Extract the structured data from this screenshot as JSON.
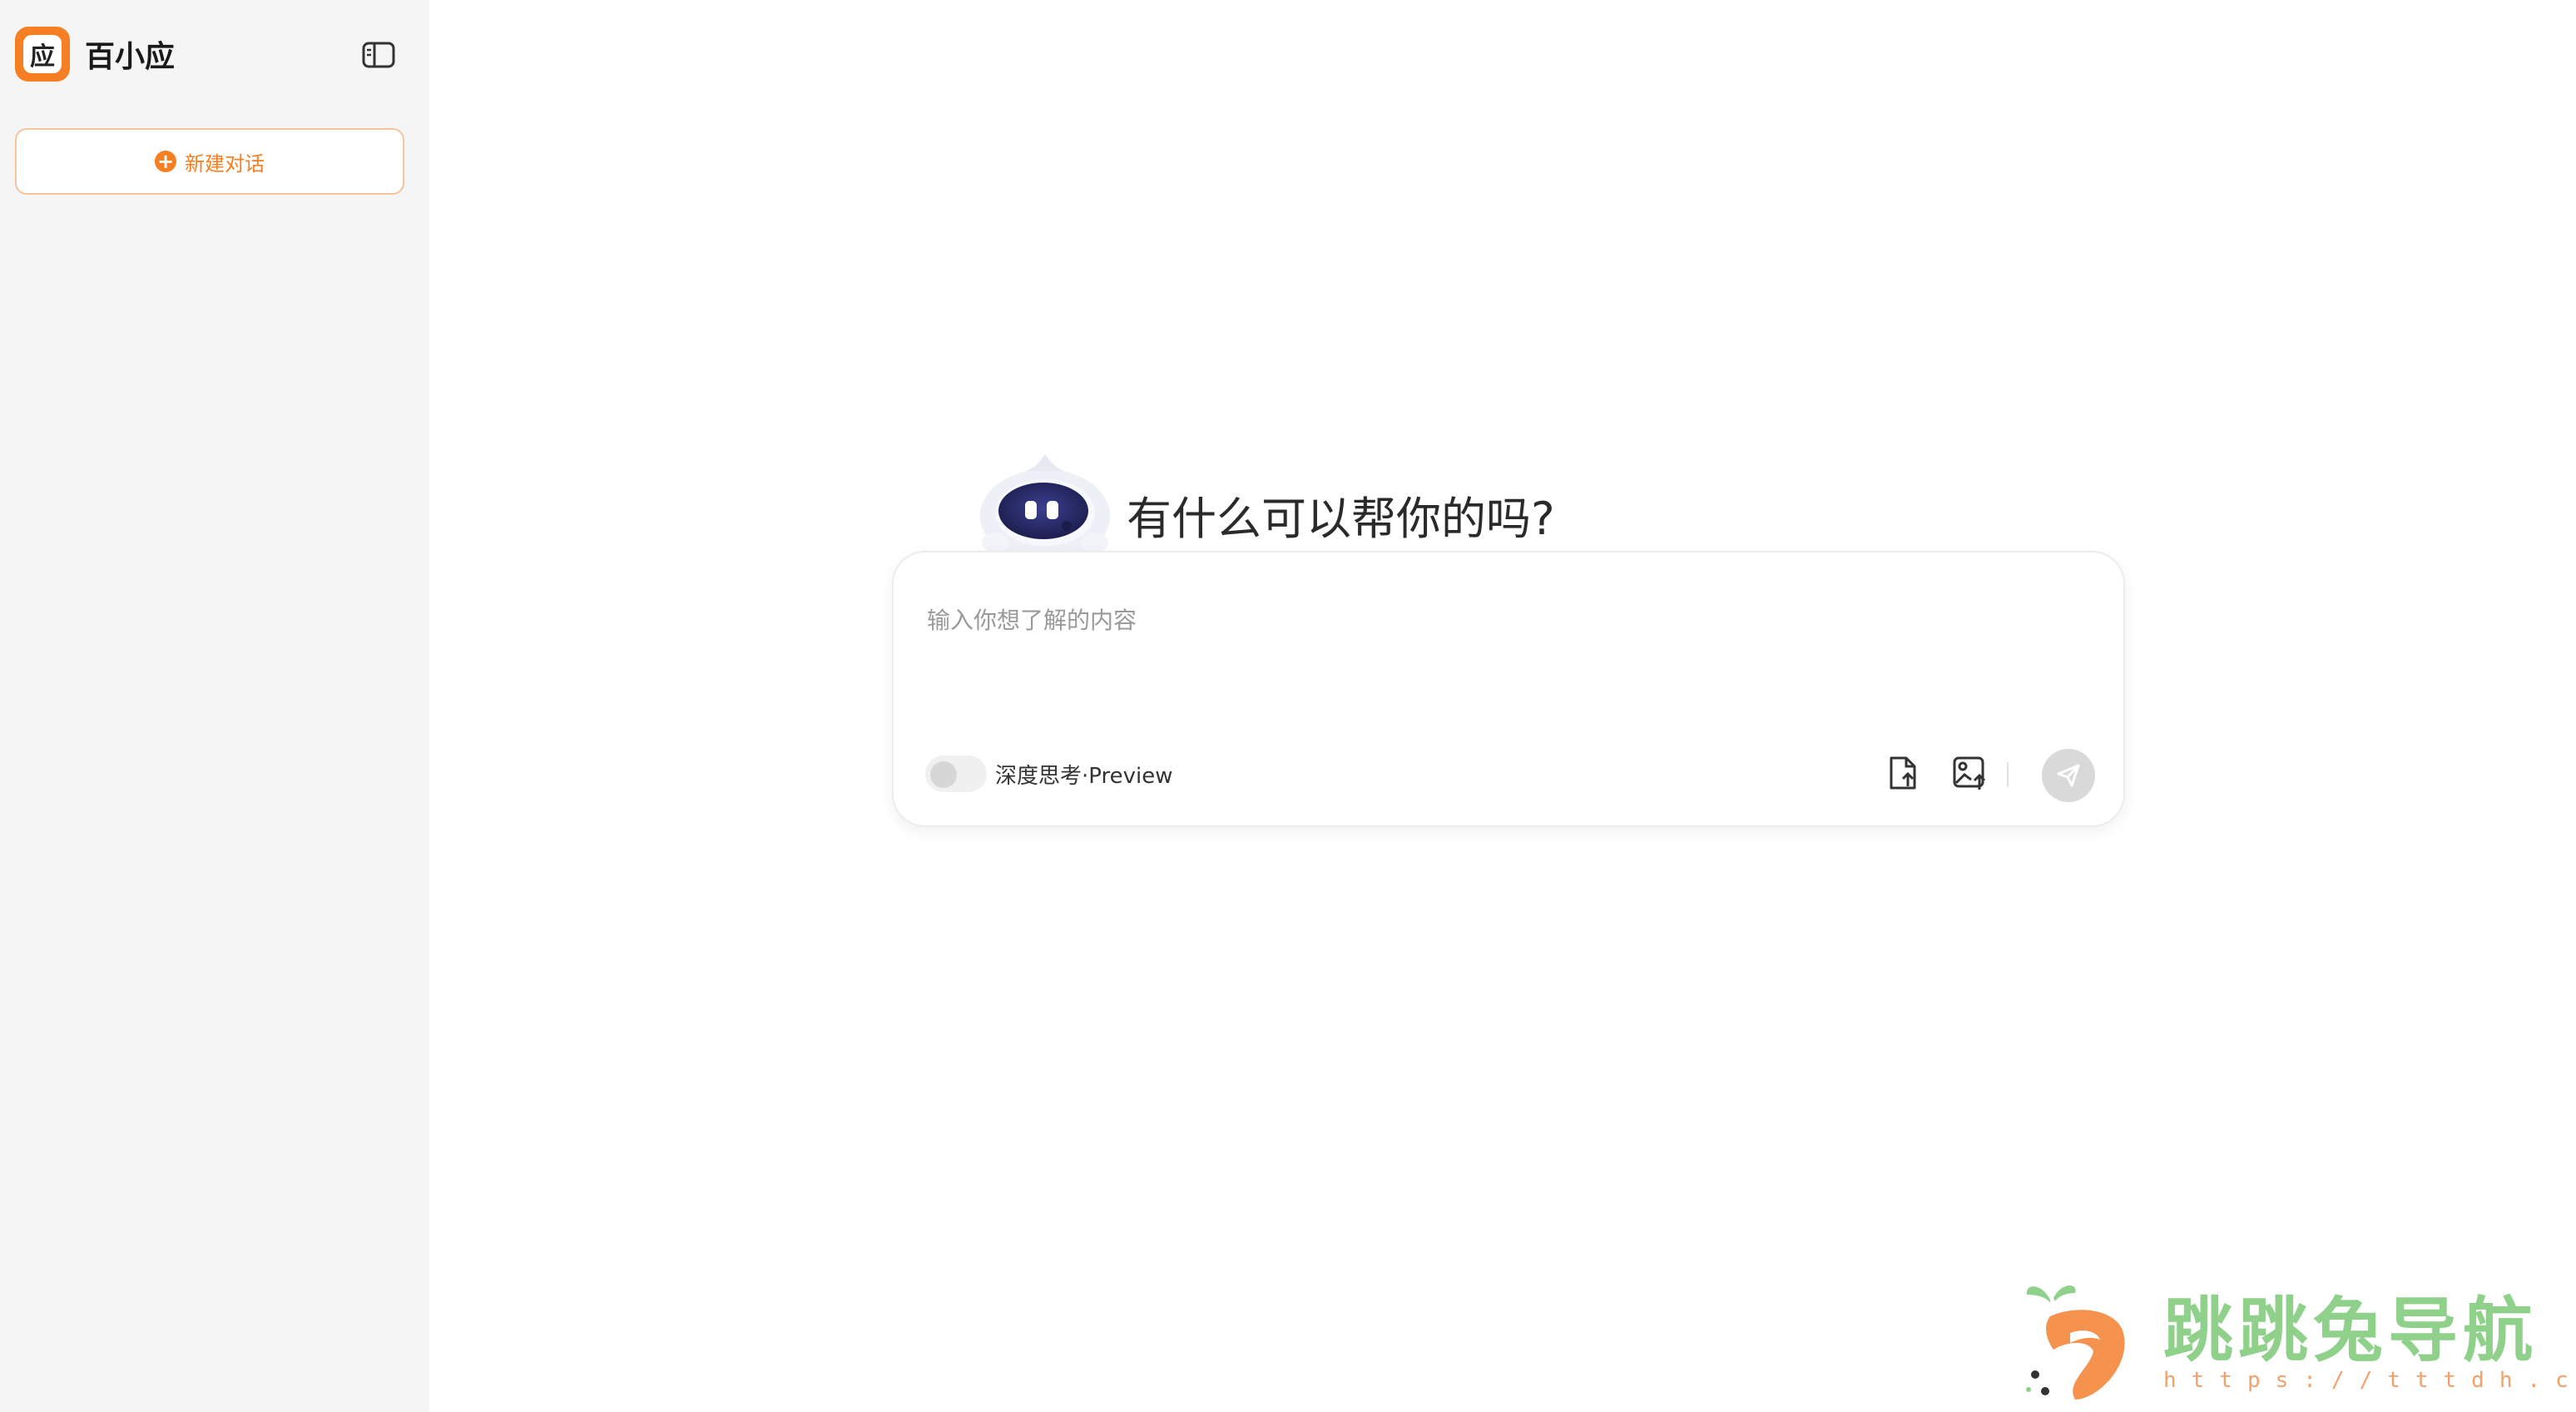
{
  "brand": {
    "name": "百小应",
    "logo_glyph": "应",
    "accent": "#f57f22"
  },
  "sidebar": {
    "new_chat_label": "新建对话",
    "collapse_icon": "sidebar-toggle-icon"
  },
  "main": {
    "greeting": "有什么可以帮你的吗?",
    "input_placeholder": "输入你想了解的内容",
    "input_value": "",
    "deep_think_label": "深度思考·Preview",
    "deep_think_enabled": false,
    "tools": {
      "upload_file_icon": "file-upload-icon",
      "upload_image_icon": "image-upload-icon",
      "send_icon": "send-icon"
    }
  },
  "watermark": {
    "title": "跳跳兔导航",
    "url": "https://tttdh.com"
  }
}
